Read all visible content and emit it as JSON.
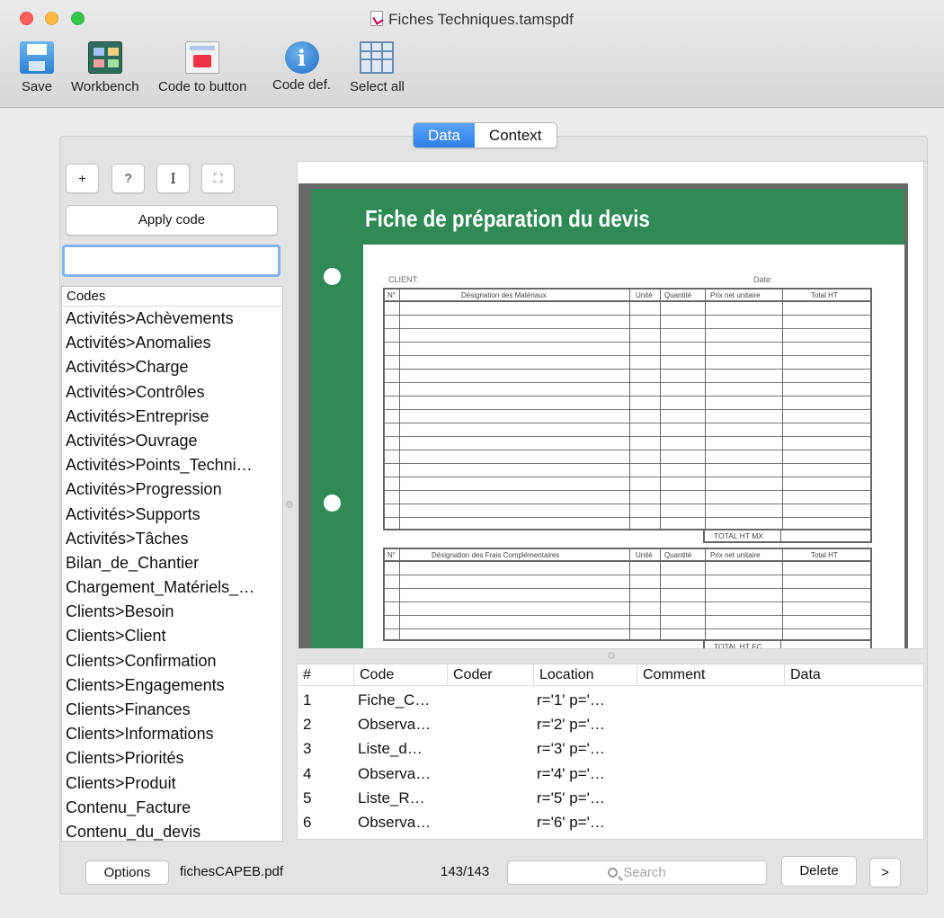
{
  "window": {
    "title": "Fiches Techniques.tamspdf"
  },
  "toolbar": {
    "save": "Save",
    "workbench": "Workbench",
    "code_to_button": "Code to button",
    "code_def": "Code def.",
    "select_all": "Select all"
  },
  "tabs": {
    "data": "Data",
    "context": "Context",
    "active": "Data"
  },
  "code_panel": {
    "add_label": "+",
    "help_label": "?",
    "text_select_label": "I",
    "region_label": "⛶",
    "apply_label": "Apply code",
    "filter_value": "",
    "list_header": "Codes",
    "items": [
      "Activités>Achèvements",
      "Activités>Anomalies",
      "Activités>Charge",
      "Activités>Contrôles",
      "Activités>Entreprise",
      "Activités>Ouvrage",
      "Activités>Points_Techni…",
      "Activités>Progression",
      "Activités>Supports",
      "Activités>Tâches",
      "Bilan_de_Chantier",
      "Chargement_Matériels_…",
      "Clients>Besoin",
      "Clients>Client",
      "Clients>Confirmation",
      "Clients>Engagements",
      "Clients>Finances",
      "Clients>Informations",
      "Clients>Priorités",
      "Clients>Produit",
      "Contenu_Facture",
      "Contenu_du_devis"
    ]
  },
  "document": {
    "title": "Fiche de préparation du devis",
    "client_label": "CLIENT:",
    "date_label": "Date:",
    "table1_headers": [
      "N°",
      "Désignation des Matériaux",
      "Unité",
      "Quantité",
      "Prix net unitaire",
      "Total HT"
    ],
    "table1_total": "TOTAL HT MX",
    "table2_headers": [
      "N°",
      "Désignation des Frais Complémentaires",
      "Unité",
      "Quantité",
      "Prix net unitaire",
      "Total HT"
    ],
    "table2_total": "TOTAL HT FC"
  },
  "quotes": {
    "headers": [
      "#",
      "Code",
      "Coder",
      "Location",
      "Comment",
      "Data"
    ],
    "rows": [
      {
        "n": "1",
        "code": "Fiche_C…",
        "coder": "",
        "location": "r='1' p='…",
        "comment": "",
        "data": ""
      },
      {
        "n": "2",
        "code": "Observa…",
        "coder": "",
        "location": "r='2' p='…",
        "comment": "",
        "data": ""
      },
      {
        "n": "3",
        "code": "Liste_d…",
        "coder": "",
        "location": "r='3' p='…",
        "comment": "",
        "data": ""
      },
      {
        "n": "4",
        "code": "Observa…",
        "coder": "",
        "location": "r='4' p='…",
        "comment": "",
        "data": ""
      },
      {
        "n": "5",
        "code": "Liste_R…",
        "coder": "",
        "location": "r='5' p='…",
        "comment": "",
        "data": ""
      },
      {
        "n": "6",
        "code": "Observa…",
        "coder": "",
        "location": "r='6' p='…",
        "comment": "",
        "data": ""
      }
    ]
  },
  "footer": {
    "options": "Options",
    "filename": "fichesCAPEB.pdf",
    "counter": "143/143",
    "search_placeholder": "Search",
    "delete": "Delete",
    "next": ">"
  },
  "colors": {
    "accent": "#2e7fe9",
    "sheet_green": "#2f8a55",
    "focus_ring": "#82b2ef"
  }
}
